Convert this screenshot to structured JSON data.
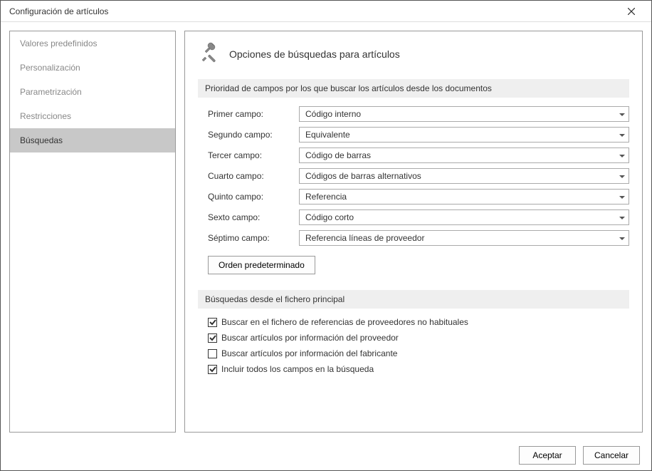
{
  "window": {
    "title": "Configuración de artículos"
  },
  "sidebar": {
    "items": [
      {
        "label": "Valores predefinidos",
        "active": false
      },
      {
        "label": "Personalización",
        "active": false
      },
      {
        "label": "Parametrización",
        "active": false
      },
      {
        "label": "Restricciones",
        "active": false
      },
      {
        "label": "Búsquedas",
        "active": true
      }
    ]
  },
  "main": {
    "title": "Opciones de búsquedas para artículos",
    "section1": {
      "heading": "Prioridad de campos por los que buscar los artículos desde los documentos",
      "fields": [
        {
          "label": "Primer campo:",
          "value": "Código interno"
        },
        {
          "label": "Segundo campo:",
          "value": "Equivalente"
        },
        {
          "label": "Tercer campo:",
          "value": "Código de barras"
        },
        {
          "label": "Cuarto campo:",
          "value": "Códigos de barras alternativos"
        },
        {
          "label": "Quinto campo:",
          "value": "Referencia"
        },
        {
          "label": "Sexto campo:",
          "value": "Código corto"
        },
        {
          "label": "Séptimo campo:",
          "value": "Referencia líneas de proveedor"
        }
      ],
      "default_btn": "Orden predeterminado"
    },
    "section2": {
      "heading": "Búsquedas desde el fichero principal",
      "checks": [
        {
          "label": "Buscar en el fichero de referencias de proveedores no habituales",
          "checked": true
        },
        {
          "label": "Buscar artículos por información del proveedor",
          "checked": true
        },
        {
          "label": "Buscar artículos por información del fabricante",
          "checked": false
        },
        {
          "label": "Incluir todos los campos en la búsqueda",
          "checked": true
        }
      ]
    }
  },
  "footer": {
    "accept": "Aceptar",
    "cancel": "Cancelar"
  }
}
